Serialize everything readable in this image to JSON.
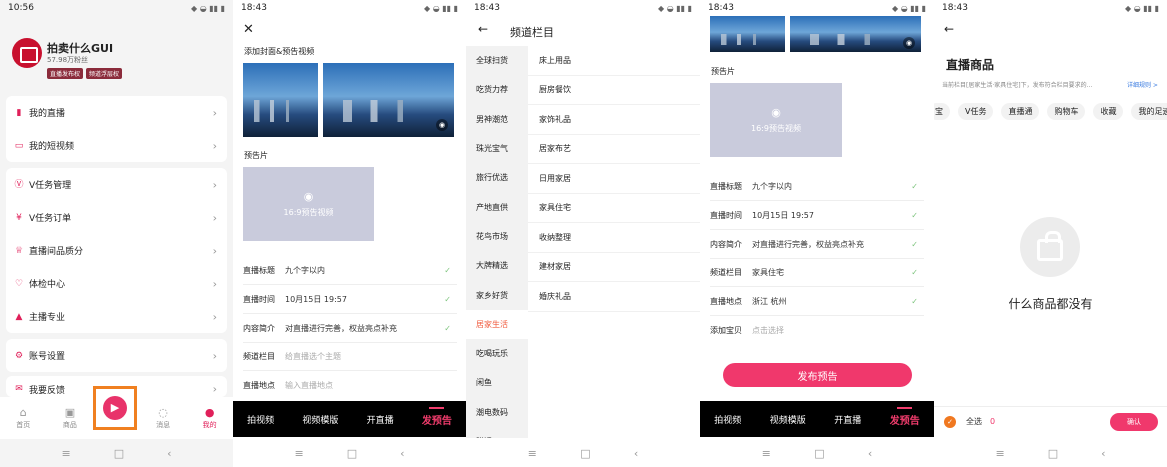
{
  "colors": {
    "accent": "#f0386c",
    "brand_red": "#c8102e",
    "orange": "#f08020"
  },
  "screen1": {
    "time": "10:56",
    "profile": {
      "name": "拍卖什么GUI",
      "fans": "57.98万粉丝",
      "badges": [
        "直播发布权",
        "频道浮层权"
      ]
    },
    "menu_group1": [
      {
        "label": "我的直播",
        "icon": "chart-icon"
      },
      {
        "label": "我的短视频",
        "icon": "video-icon"
      }
    ],
    "menu_group2": [
      {
        "label": "V任务管理",
        "icon": "v-task-icon"
      },
      {
        "label": "V任务订单",
        "icon": "order-icon"
      },
      {
        "label": "直播间品质分",
        "icon": "trophy-icon"
      },
      {
        "label": "体检中心",
        "icon": "health-icon"
      },
      {
        "label": "主播专业",
        "icon": "graduation-icon"
      }
    ],
    "menu_group3": [
      {
        "label": "账号设置",
        "icon": "settings-icon"
      }
    ],
    "menu_group4": [
      {
        "label": "我要反馈",
        "icon": "feedback-icon"
      }
    ],
    "tabs": [
      "首页",
      "商品",
      "消息",
      "我的"
    ]
  },
  "screen2": {
    "time": "18:43",
    "cover_label": "添加封面&预告视频",
    "preview_label": "预告片",
    "video_placeholder": "16:9预告视频",
    "form": [
      {
        "label": "直播标题",
        "value": "九个字以内",
        "placeholder": false,
        "ok": true
      },
      {
        "label": "直播时间",
        "value": "10月15日 19:57",
        "placeholder": false,
        "ok": true
      },
      {
        "label": "内容简介",
        "value": "对直播进行完善，权益亮点补充",
        "placeholder": false,
        "ok": true
      },
      {
        "label": "频道栏目",
        "value": "给直播选个主题",
        "placeholder": true,
        "ok": false
      },
      {
        "label": "直播地点",
        "value": "输入直播地点",
        "placeholder": true,
        "ok": false
      }
    ],
    "actions": [
      "拍视频",
      "视频模版",
      "开直播",
      "发预告"
    ]
  },
  "screen3": {
    "time": "18:43",
    "title": "频道栏目",
    "left": [
      "全球扫货",
      "吃货力荐",
      "男神潮范",
      "珠光宝气",
      "旅行优选",
      "产地直供",
      "花鸟市场",
      "大牌精选",
      "家乡好货",
      "居家生活",
      "吃喝玩乐",
      "闲鱼",
      "潮电数码",
      "附近"
    ],
    "left_active": 9,
    "right": [
      "床上用品",
      "厨房餐饮",
      "家饰礼品",
      "居家布艺",
      "日用家居",
      "家具住宅",
      "收纳整理",
      "建材家居",
      "婚庆礼品"
    ]
  },
  "screen4": {
    "time": "18:43",
    "preview_label": "预告片",
    "video_placeholder": "16:9预告视频",
    "form": [
      {
        "label": "直播标题",
        "value": "九个字以内",
        "ok": true
      },
      {
        "label": "直播时间",
        "value": "10月15日 19:57",
        "ok": true
      },
      {
        "label": "内容简介",
        "value": "对直播进行完善，权益亮点补充",
        "ok": true
      },
      {
        "label": "频道栏目",
        "value": "家具住宅",
        "ok": true
      },
      {
        "label": "直播地点",
        "value": "浙江 杭州",
        "ok": true
      },
      {
        "label": "添加宝贝",
        "value": "点击选择",
        "ok": false
      }
    ],
    "publish_label": "发布预告",
    "actions": [
      "拍视频",
      "视频模版",
      "开直播",
      "发预告"
    ]
  },
  "screen5": {
    "time": "18:43",
    "title": "直播商品",
    "desc": "当前栏目[居家生活·家具住宅]下，发布符合栏目要求的...",
    "rule_link": "详细规则 >",
    "chips": [
      "宝",
      "V任务",
      "直播通",
      "购物车",
      "收藏",
      "我的足迹"
    ],
    "empty_text": "什么商品都没有",
    "select_all": "全选",
    "count": "0",
    "confirm": "确认"
  }
}
